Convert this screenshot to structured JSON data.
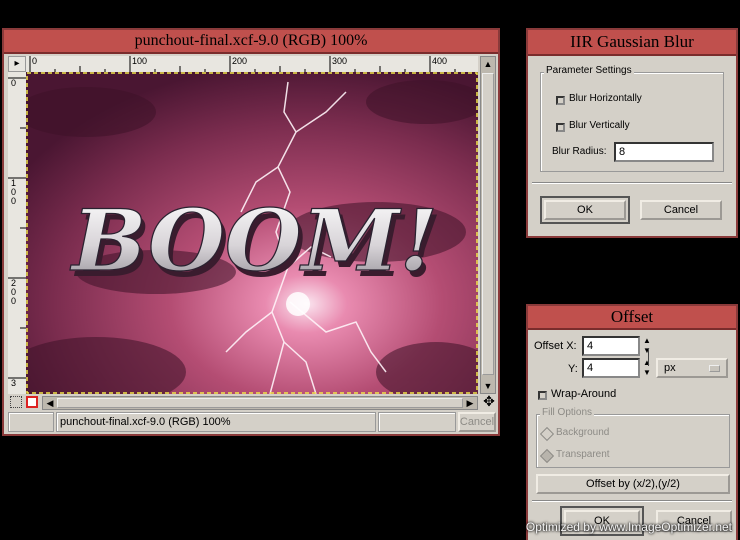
{
  "image_window": {
    "title": "punchout-final.xcf-9.0 (RGB) 100%",
    "status_text": "punchout-final.xcf-9.0 (RGB) 100%",
    "cancel_label": "Cancel",
    "ruler_h": [
      "0",
      "100",
      "200",
      "300",
      "400"
    ],
    "ruler_v": [
      "0",
      "1\n0\n0",
      "2\n0\n0",
      "3"
    ],
    "canvas_text": "BOOM!"
  },
  "blur_dialog": {
    "title": "IIR Gaussian Blur",
    "group_label": "Parameter Settings",
    "blur_horizontally": "Blur Horizontally",
    "blur_vertically": "Blur Vertically",
    "radius_label": "Blur Radius:",
    "radius_value": "8",
    "ok_label": "OK",
    "cancel_label": "Cancel"
  },
  "offset_dialog": {
    "title": "Offset",
    "offset_x_label": "Offset X:",
    "offset_x_value": "4",
    "offset_y_label": "Y:",
    "offset_y_value": "4",
    "unit": "px",
    "wrap_around": "Wrap-Around",
    "fill_options_label": "Fill Options",
    "background": "Background",
    "transparent": "Transparent",
    "offset_half_label": "Offset by (x/2),(y/2)",
    "ok_label": "OK",
    "cancel_label": "Cancel"
  },
  "watermark": "Optimized by www.ImageOptimizer.net",
  "colors": {
    "title_bg": "#c0504d",
    "window_bg": "#d4d0c8",
    "canvas_sky": "#9b3d59"
  }
}
